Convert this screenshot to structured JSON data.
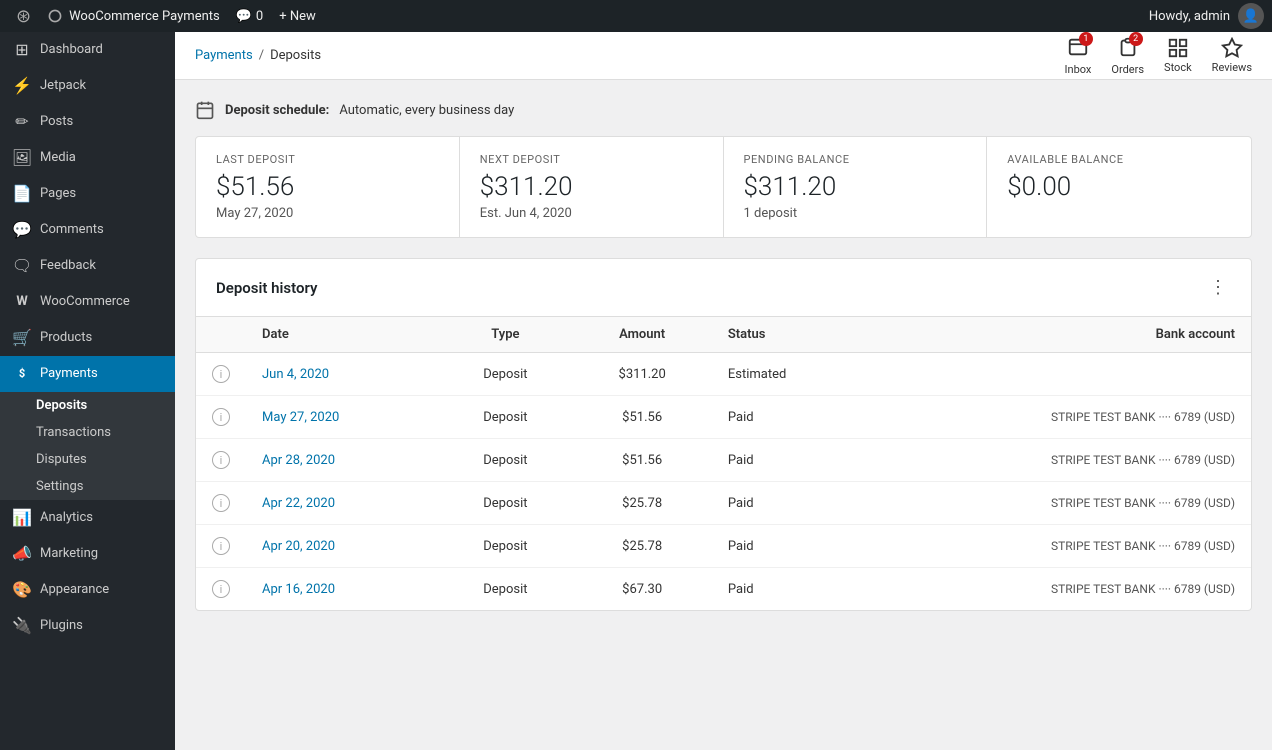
{
  "adminBar": {
    "logo": "W",
    "site": "WooCommerce Payments",
    "comments": "0",
    "new": "+ New",
    "greeting": "Howdy, admin"
  },
  "sidebar": {
    "items": [
      {
        "id": "dashboard",
        "label": "Dashboard",
        "icon": "⊞"
      },
      {
        "id": "jetpack",
        "label": "Jetpack",
        "icon": "⚡"
      },
      {
        "id": "posts",
        "label": "Posts",
        "icon": "📝"
      },
      {
        "id": "media",
        "label": "Media",
        "icon": "🖼"
      },
      {
        "id": "pages",
        "label": "Pages",
        "icon": "📄"
      },
      {
        "id": "comments",
        "label": "Comments",
        "icon": "💬"
      },
      {
        "id": "feedback",
        "label": "Feedback",
        "icon": "🗨"
      },
      {
        "id": "woocommerce",
        "label": "WooCommerce",
        "icon": "W"
      },
      {
        "id": "products",
        "label": "Products",
        "icon": "🛒"
      },
      {
        "id": "payments",
        "label": "Payments",
        "icon": "$",
        "active": true
      }
    ],
    "paymentsSubItems": [
      {
        "id": "deposits",
        "label": "Deposits",
        "active": true
      },
      {
        "id": "transactions",
        "label": "Transactions",
        "active": false
      },
      {
        "id": "disputes",
        "label": "Disputes",
        "active": false
      },
      {
        "id": "settings",
        "label": "Settings",
        "active": false
      }
    ],
    "bottomItems": [
      {
        "id": "analytics",
        "label": "Analytics",
        "icon": "📊"
      },
      {
        "id": "marketing",
        "label": "Marketing",
        "icon": "📣"
      },
      {
        "id": "appearance",
        "label": "Appearance",
        "icon": "🎨"
      },
      {
        "id": "plugins",
        "label": "Plugins",
        "icon": "🔌"
      }
    ]
  },
  "topBar": {
    "breadcrumb": {
      "parent": "Payments",
      "separator": "/",
      "current": "Deposits"
    },
    "actions": [
      {
        "id": "inbox",
        "label": "Inbox",
        "badge": "1"
      },
      {
        "id": "orders",
        "label": "Orders",
        "badge": "2"
      },
      {
        "id": "stock",
        "label": "Stock",
        "badge": null
      },
      {
        "id": "reviews",
        "label": "Reviews",
        "badge": null
      }
    ]
  },
  "depositSchedule": {
    "label": "Deposit schedule:",
    "value": "Automatic, every business day"
  },
  "stats": [
    {
      "id": "last-deposit",
      "label": "LAST DEPOSIT",
      "value": "$51.56",
      "sub": "May 27, 2020"
    },
    {
      "id": "next-deposit",
      "label": "NEXT DEPOSIT",
      "value": "$311.20",
      "sub": "Est. Jun 4, 2020"
    },
    {
      "id": "pending-balance",
      "label": "PENDING BALANCE",
      "value": "$311.20",
      "sub": "1 deposit"
    },
    {
      "id": "available-balance",
      "label": "AVAILABLE BALANCE",
      "value": "$0.00",
      "sub": ""
    }
  ],
  "depositHistory": {
    "title": "Deposit history",
    "columns": [
      "Date",
      "Type",
      "Amount",
      "Status",
      "Bank account"
    ],
    "rows": [
      {
        "date": "Jun 4, 2020",
        "type": "Deposit",
        "amount": "$311.20",
        "status": "Estimated",
        "bank": ""
      },
      {
        "date": "May 27, 2020",
        "type": "Deposit",
        "amount": "$51.56",
        "status": "Paid",
        "bank": "STRIPE TEST BANK ···· 6789 (USD)"
      },
      {
        "date": "Apr 28, 2020",
        "type": "Deposit",
        "amount": "$51.56",
        "status": "Paid",
        "bank": "STRIPE TEST BANK ···· 6789 (USD)"
      },
      {
        "date": "Apr 22, 2020",
        "type": "Deposit",
        "amount": "$25.78",
        "status": "Paid",
        "bank": "STRIPE TEST BANK ···· 6789 (USD)"
      },
      {
        "date": "Apr 20, 2020",
        "type": "Deposit",
        "amount": "$25.78",
        "status": "Paid",
        "bank": "STRIPE TEST BANK ···· 6789 (USD)"
      },
      {
        "date": "Apr 16, 2020",
        "type": "Deposit",
        "amount": "$67.30",
        "status": "Paid",
        "bank": "STRIPE TEST BANK ···· 6789 (USD)"
      }
    ]
  }
}
